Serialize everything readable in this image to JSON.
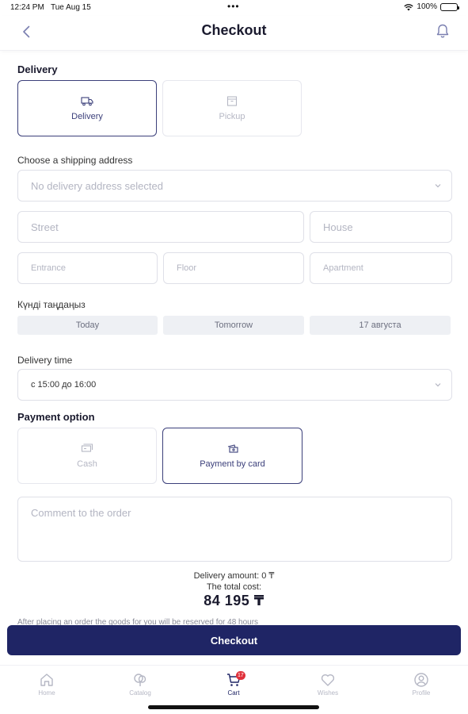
{
  "status_bar": {
    "time": "12:24 PM",
    "date": "Tue Aug 15",
    "dots": "•••",
    "battery": "100%"
  },
  "header": {
    "title": "Checkout"
  },
  "delivery": {
    "section_title": "Delivery",
    "methods": [
      {
        "label": "Delivery",
        "icon": "truck-icon",
        "active": true
      },
      {
        "label": "Pickup",
        "icon": "box-icon",
        "active": false
      }
    ]
  },
  "address": {
    "label": "Choose a shipping address",
    "select_value": "No delivery address selected",
    "street_placeholder": "Street",
    "house_placeholder": "House",
    "entrance_placeholder": "Entrance",
    "floor_placeholder": "Floor",
    "apartment_placeholder": "Apartment"
  },
  "date": {
    "label": "Күнді таңдаңыз",
    "options": [
      "Today",
      "Tomorrow",
      "17 августа"
    ]
  },
  "time": {
    "label": "Delivery time",
    "select_value": "с 15:00 до 16:00"
  },
  "payment": {
    "section_title": "Payment option",
    "methods": [
      {
        "label": "Cash",
        "icon": "cash-icon",
        "active": false
      },
      {
        "label": "Payment by card",
        "icon": "card-icon",
        "active": true
      }
    ]
  },
  "comment": {
    "placeholder": "Comment to the order"
  },
  "summary": {
    "delivery_amount": "Delivery amount: 0 ₸",
    "total_label": "The total cost:",
    "total_value": "84 195 ₸"
  },
  "notice": "After placing an order the goods for you will be reserved for 48 hours",
  "checkout_button": "Checkout",
  "tabbar": {
    "items": [
      {
        "label": "Home",
        "icon": "home-icon"
      },
      {
        "label": "Catalog",
        "icon": "catalog-icon"
      },
      {
        "label": "Cart",
        "icon": "cart-icon",
        "active": true,
        "badge": "17"
      },
      {
        "label": "Wishes",
        "icon": "heart-icon"
      },
      {
        "label": "Profile",
        "icon": "profile-icon"
      }
    ]
  },
  "colors": {
    "primary": "#1f2565",
    "accent_border": "#3b3f7a",
    "badge": "#e0313b",
    "chip_bg": "#eef0f4"
  }
}
